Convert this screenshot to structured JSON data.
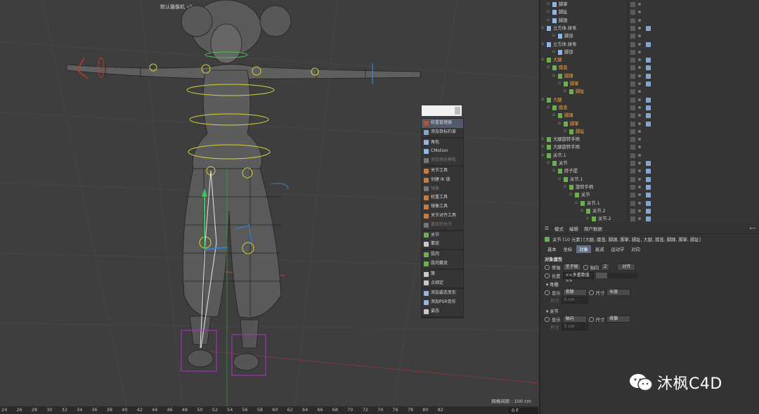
{
  "viewport": {
    "camera_label": "默认摄像机 ∘°",
    "grid_spacing": "网格间距 : 100 cm"
  },
  "timeline": {
    "ticks": [
      "24",
      "26",
      "28",
      "30",
      "32",
      "34",
      "36",
      "38",
      "40",
      "42",
      "44",
      "46",
      "48",
      "50",
      "52",
      "54",
      "56",
      "58",
      "60",
      "62",
      "64",
      "66",
      "68",
      "70",
      "72",
      "74",
      "76",
      "78",
      "80",
      "82"
    ],
    "current_frame": "0 F"
  },
  "context_menu": {
    "groups": [
      [
        {
          "label": "权重管理器",
          "icon": "weight-manager-icon",
          "color": "#c04b3a",
          "highlight": true
        },
        {
          "label": "添加目标约束",
          "icon": "target-constraint-icon",
          "color": "#7fa6d8"
        }
      ],
      [
        {
          "label": "角色",
          "icon": "character-icon",
          "color": "#8fb6e6"
        },
        {
          "label": "CMotion",
          "icon": "cmotion-icon",
          "color": "#8fb6e6"
        },
        {
          "label": "添加角色模板",
          "icon": "character-template-icon",
          "color": "#777",
          "dim": true
        }
      ],
      [
        {
          "label": "关节工具",
          "icon": "joint-tool-icon",
          "color": "#d07a3a"
        },
        {
          "label": "创建 IK 链",
          "icon": "ik-chain-icon",
          "color": "#d07a3a"
        },
        {
          "label": "镜像",
          "icon": "mirror-icon",
          "color": "#777",
          "dim": true
        },
        {
          "label": "权重工具",
          "icon": "weight-tool-icon",
          "color": "#d07a3a"
        },
        {
          "label": "镜像工具",
          "icon": "mirror-tool-icon",
          "color": "#d07a3a"
        },
        {
          "label": "关节对齐工具",
          "icon": "joint-align-icon",
          "color": "#d07a3a"
        },
        {
          "label": "蒙皮转关节",
          "icon": "skin-to-joint-icon",
          "color": "#777",
          "dim": true
        }
      ],
      [
        {
          "label": "关节",
          "icon": "joint-icon",
          "color": "#6ab04c"
        },
        {
          "label": "蒙皮",
          "icon": "skin-icon",
          "color": "#c9c9c9"
        }
      ],
      [
        {
          "label": "肌肉",
          "icon": "muscle-icon",
          "color": "#6ab04c"
        },
        {
          "label": "肌肉蒙皮",
          "icon": "muscle-skin-icon",
          "color": "#6ab04c"
        }
      ],
      [
        {
          "label": "簇",
          "icon": "cluster-icon",
          "color": "#c9c9c9"
        },
        {
          "label": "点绑定",
          "icon": "point-bind-icon",
          "color": "#c9c9c9"
        }
      ],
      [
        {
          "label": "添加姿态变形",
          "icon": "pose-morph-icon",
          "color": "#8fb6e6"
        },
        {
          "label": "添加PSR变形",
          "icon": "psr-morph-icon",
          "color": "#8fb6e6"
        },
        {
          "label": "姿态",
          "icon": "pose-icon",
          "color": "#c9c9c9"
        }
      ]
    ]
  },
  "object_manager": {
    "rows": [
      {
        "name": "脚掌",
        "indent": 1,
        "icon": "#8fb6e6",
        "selected": false
      },
      {
        "name": "脚趾",
        "indent": 1,
        "icon": "#8fb6e6",
        "selected": false
      },
      {
        "name": "脚跟",
        "indent": 1,
        "icon": "#8fb6e6",
        "selected": false
      },
      {
        "name": "立方体.拼条",
        "indent": 0,
        "icon": "#8fb6e6",
        "selected": false,
        "tag": "#7fa6d8"
      },
      {
        "name": "脚部",
        "indent": 2,
        "icon": "#8fb6e6",
        "selected": false
      },
      {
        "name": "立方体.拼条",
        "indent": 0,
        "icon": "#8fb6e6",
        "selected": false,
        "tag": "#7fa6d8"
      },
      {
        "name": "脚部",
        "indent": 2,
        "icon": "#8fb6e6",
        "selected": false
      },
      {
        "name": "大腿",
        "indent": 0,
        "icon": "#6ab04c",
        "selected": true,
        "tag": "#7fa6d8"
      },
      {
        "name": "膝盖",
        "indent": 1,
        "icon": "#6ab04c",
        "selected": true,
        "tag": "#7fa6d8"
      },
      {
        "name": "脚踝",
        "indent": 2,
        "icon": "#6ab04c",
        "selected": true,
        "tag": "#7fa6d8"
      },
      {
        "name": "脚掌",
        "indent": 3,
        "icon": "#6ab04c",
        "selected": true,
        "tag": "#7fa6d8"
      },
      {
        "name": "脚趾",
        "indent": 4,
        "icon": "#6ab04c",
        "selected": true
      },
      {
        "name": "大腿",
        "indent": 0,
        "icon": "#6ab04c",
        "selected": true,
        "tag": "#7fa6d8"
      },
      {
        "name": "膝盖",
        "indent": 1,
        "icon": "#6ab04c",
        "selected": true,
        "tag": "#7fa6d8"
      },
      {
        "name": "脚踝",
        "indent": 2,
        "icon": "#6ab04c",
        "selected": true,
        "tag": "#7fa6d8"
      },
      {
        "name": "脚掌",
        "indent": 3,
        "icon": "#6ab04c",
        "selected": true,
        "tag": "#7fa6d8"
      },
      {
        "name": "脚趾",
        "indent": 4,
        "icon": "#6ab04c",
        "selected": true
      },
      {
        "name": "大腿旋转手柄",
        "indent": 0,
        "icon": "#6ab04c",
        "selected": false
      },
      {
        "name": "大腿旋转手柄",
        "indent": 0,
        "icon": "#6ab04c",
        "selected": false
      },
      {
        "name": "关节.1",
        "indent": 0,
        "icon": "#6ab04c",
        "selected": false
      },
      {
        "name": "关节",
        "indent": 1,
        "icon": "#6ab04c",
        "selected": false,
        "tag": "#7fa6d8"
      },
      {
        "name": "脖子提",
        "indent": 2,
        "icon": "#6ab04c",
        "selected": false,
        "tag": "#7fa6d8"
      },
      {
        "name": "关节.1",
        "indent": 3,
        "icon": "#6ab04c",
        "selected": false,
        "tag": "#7fa6d8"
      },
      {
        "name": "旋转手柄",
        "indent": 4,
        "icon": "#6ab04c",
        "selected": false,
        "tag": "#7fa6d8"
      },
      {
        "name": "关节",
        "indent": 5,
        "icon": "#6ab04c",
        "selected": false,
        "tag": "#7fa6d8"
      },
      {
        "name": "关节.1",
        "indent": 6,
        "icon": "#6ab04c",
        "selected": false,
        "tag": "#7fa6d8"
      },
      {
        "name": "关节.2",
        "indent": 7,
        "icon": "#6ab04c",
        "selected": false,
        "tag": "#7fa6d8"
      },
      {
        "name": "关节.2",
        "indent": 8,
        "icon": "#6ab04c",
        "selected": false,
        "tag": "#7fa6d8"
      }
    ]
  },
  "attributes": {
    "menu": [
      "模式",
      "编辑",
      "用户数据"
    ],
    "title": "关节 [10 元素] [大腿, 膝盖, 脚踝, 脚掌, 脚趾, 大腿, 膝盖, 脚踝, 脚掌, 脚趾]",
    "tabs": [
      "基本",
      "坐标",
      "对象",
      "衰减",
      "运动学",
      "对向"
    ],
    "active_tab": "对象",
    "section_object": "对象属性",
    "align_label": "骨轴",
    "align_value": "至子级",
    "axis_label": "轴向",
    "axis_value": "Z",
    "align_button": "对齐",
    "length_label": "长度",
    "length_value": "<<多重数值>>",
    "bone_section": "骨骼",
    "bone_display_label": "显示",
    "bone_display_value": "骨骼",
    "bone_size_label": "尺寸",
    "bone_size_value": "长度",
    "bone_width_label": "尺寸",
    "bone_width_value": "5 cm",
    "joint_section": "关节",
    "joint_display_label": "显示",
    "joint_display_value": "轴向",
    "joint_size_label": "尺寸",
    "joint_size_value": "骨骼",
    "joint_width_label": "尺寸",
    "joint_width_value": "5 cm"
  },
  "watermark": {
    "text": "沐枫C4D"
  }
}
